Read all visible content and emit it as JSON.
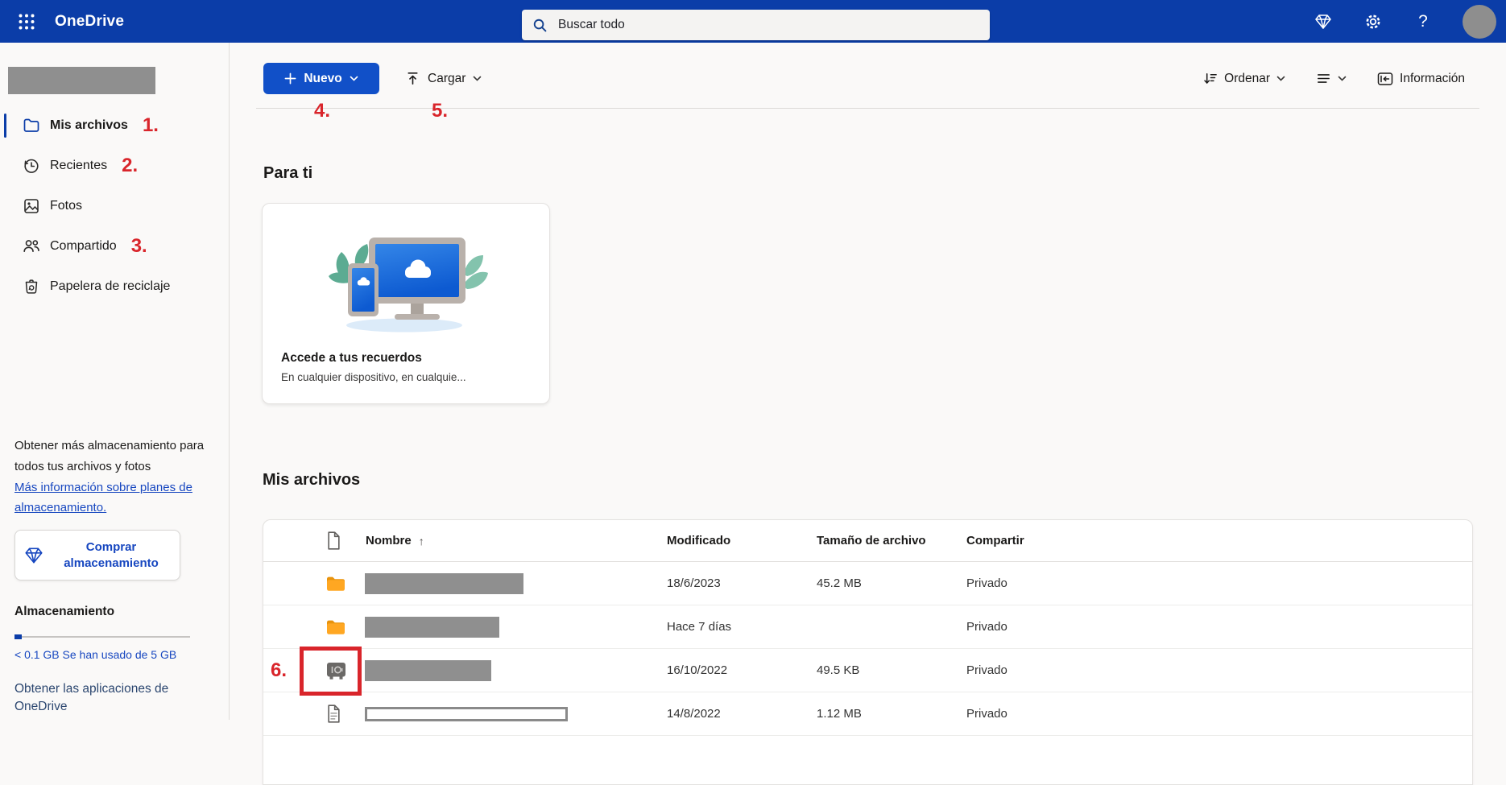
{
  "topbar": {
    "app_name": "OneDrive",
    "search_placeholder": "Buscar todo"
  },
  "sidebar": {
    "items": [
      {
        "label": "Mis archivos",
        "annotation": "1."
      },
      {
        "label": "Recientes",
        "annotation": "2."
      },
      {
        "label": "Fotos",
        "annotation": ""
      },
      {
        "label": "Compartido",
        "annotation": "3."
      },
      {
        "label": "Papelera de reciclaje",
        "annotation": ""
      }
    ],
    "upsell_text": "Obtener más almacenamiento para todos tus archivos y fotos",
    "upsell_link": "Más información sobre planes de almacenamiento.",
    "buy_storage_label": "Comprar almacenamiento",
    "storage_heading": "Almacenamiento",
    "storage_usage": "< 0.1 GB Se han usado de 5 GB",
    "get_apps": "Obtener las aplicaciones de OneDrive"
  },
  "toolbar": {
    "new_label": "Nuevo",
    "new_annotation": "4.",
    "upload_label": "Cargar",
    "upload_annotation": "5.",
    "sort_label": "Ordenar",
    "info_label": "Información"
  },
  "main": {
    "for_you_heading": "Para ti",
    "promo_card": {
      "title": "Accede a tus recuerdos",
      "subtitle": "En cualquier dispositivo, en cualquie..."
    },
    "files_heading": "Mis archivos",
    "table": {
      "columns": {
        "name": "Nombre",
        "modified": "Modificado",
        "size": "Tamaño de archivo",
        "share": "Compartir"
      },
      "sort_arrow": "↑",
      "rows": [
        {
          "type": "folder",
          "modified": "18/6/2023",
          "size": "45.2 MB",
          "share": "Privado",
          "annotation": ""
        },
        {
          "type": "folder",
          "modified": "Hace 7 días",
          "size": "",
          "share": "Privado",
          "annotation": ""
        },
        {
          "type": "vault",
          "modified": "16/10/2022",
          "size": "49.5 KB",
          "share": "Privado",
          "annotation": "6."
        },
        {
          "type": "document",
          "modified": "14/8/2022",
          "size": "1.12 MB",
          "share": "Privado",
          "annotation": ""
        }
      ]
    }
  },
  "icons": {
    "waffle": "app-launcher grid of dots",
    "search": "magnifier",
    "diamond": "premium gem",
    "gear": "settings",
    "help": "?",
    "folder": "orange filled folder",
    "clock": "recent history clock",
    "photo": "image with mountain",
    "people": "two persons",
    "recycle-bin": "trash can with recycle arrows",
    "vault": "gray personal-vault safe",
    "document": "page with folded corner",
    "upload": "arrow up with bar",
    "sort": "arrow down with lines",
    "view": "three horizontal lines",
    "info-panel": "pane with left arrow"
  },
  "colors": {
    "topbar": "#0b3da8",
    "primary_button": "#1150c8",
    "annotation_red": "#d9252b",
    "link_blue": "#1747c0",
    "folder_orange": "#ffa722"
  }
}
